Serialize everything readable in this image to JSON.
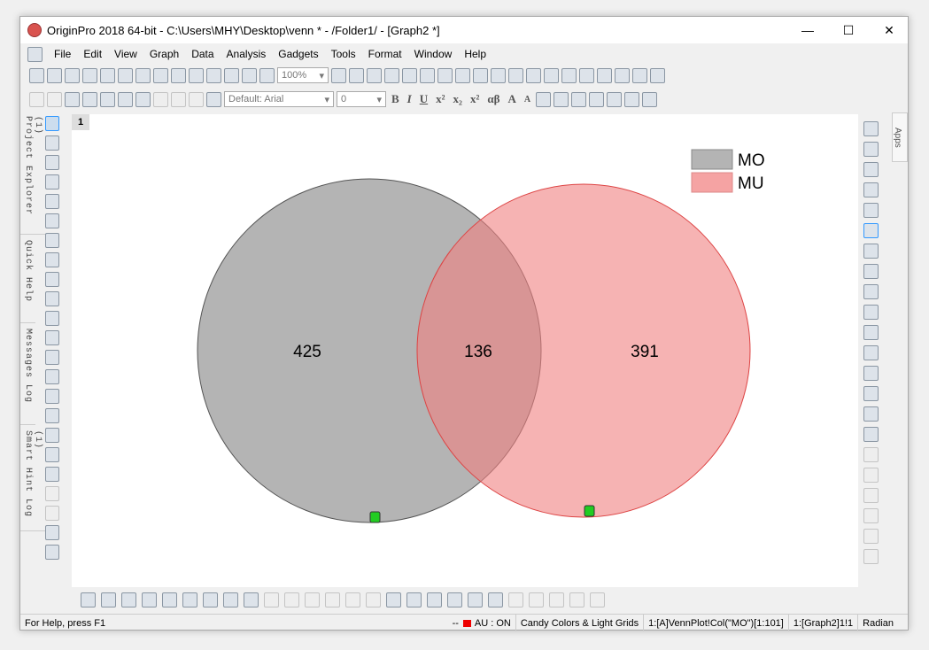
{
  "window": {
    "title": "OriginPro 2018 64-bit - C:\\Users\\MHY\\Desktop\\venn * - /Folder1/ - [Graph2 *]",
    "minimize": "—",
    "maximize": "☐",
    "close": "✕"
  },
  "menu": [
    "File",
    "Edit",
    "View",
    "Graph",
    "Data",
    "Analysis",
    "Gadgets",
    "Tools",
    "Format",
    "Window",
    "Help"
  ],
  "toolbar": {
    "zoom": "100%",
    "font": "Default: Arial",
    "font_size": "0",
    "format_buttons": [
      "B",
      "I",
      "U",
      "x²",
      "x₂",
      "x²",
      "αβ",
      "A",
      "A"
    ]
  },
  "left_tabs": [
    "Project Explorer (1)",
    "Quick Help",
    "Messages Log",
    "Smart Hint Log (1)"
  ],
  "apps_tab": "Apps",
  "graph": {
    "layer": "1",
    "legend": [
      {
        "label": "MO",
        "color": "#b4b4b4"
      },
      {
        "label": "MU",
        "color": "#f5a3a3"
      }
    ],
    "sets": [
      {
        "name": "MO",
        "only": "425",
        "color": "#b4b4b4"
      },
      {
        "name": "MU",
        "only": "391",
        "color": "#f5a3a3"
      }
    ],
    "intersection": "136"
  },
  "status": {
    "help": "For Help, press F1",
    "dash": "--",
    "au": "AU : ON",
    "theme": "Candy Colors & Light Grids",
    "column": "1:[A]VennPlot!Col(\"MO\")[1:101]",
    "graph": "1:[Graph2]1!1",
    "angle": "Radian"
  }
}
